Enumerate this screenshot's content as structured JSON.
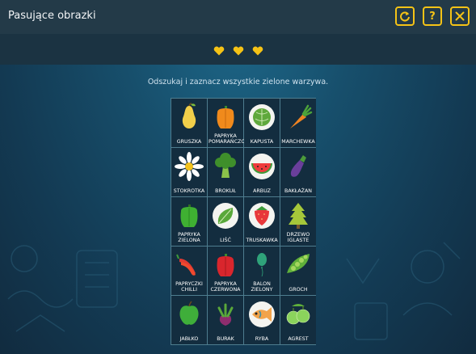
{
  "header": {
    "title": "Pasujące obrazki",
    "buttons": {
      "refresh": "⟳",
      "help": "?",
      "close": "✕"
    }
  },
  "lives": {
    "count": 3,
    "color": "#f5c316"
  },
  "instruction": "Odszukaj i zaznacz wszystkie zielone warzywa.",
  "grid": {
    "columns": 4,
    "items": [
      {
        "label": "GRUSZKA",
        "icon": "pear-icon"
      },
      {
        "label": "PAPRYKA POMARAŃCZOW",
        "icon": "orange-pepper-icon"
      },
      {
        "label": "KAPUSTA",
        "icon": "cabbage-icon"
      },
      {
        "label": "MARCHEWKA",
        "icon": "carrot-icon"
      },
      {
        "label": "STOKROTKA",
        "icon": "daisy-icon"
      },
      {
        "label": "BROKUŁ",
        "icon": "broccoli-icon"
      },
      {
        "label": "ARBUZ",
        "icon": "watermelon-icon"
      },
      {
        "label": "BAKŁAŻAN",
        "icon": "eggplant-icon"
      },
      {
        "label": "PAPRYKA\nZIELONA",
        "icon": "green-pepper-icon"
      },
      {
        "label": "LIŚĆ",
        "icon": "leaf-icon"
      },
      {
        "label": "TRUSKAWKA",
        "icon": "strawberry-icon"
      },
      {
        "label": "DRZEWO\nIGLASTE",
        "icon": "conifer-tree-icon"
      },
      {
        "label": "PAPRYCZKI\nCHILLI",
        "icon": "chili-pepper-icon"
      },
      {
        "label": "PAPRYKA\nCZERWONA",
        "icon": "red-pepper-icon"
      },
      {
        "label": "BALON\nZIELONY",
        "icon": "green-balloon-icon"
      },
      {
        "label": "GROCH",
        "icon": "peas-icon"
      },
      {
        "label": "JABŁKO",
        "icon": "apple-icon"
      },
      {
        "label": "BURAK",
        "icon": "beet-icon"
      },
      {
        "label": "RYBA",
        "icon": "fish-icon"
      },
      {
        "label": "AGREST",
        "icon": "gooseberry-icon"
      }
    ]
  }
}
